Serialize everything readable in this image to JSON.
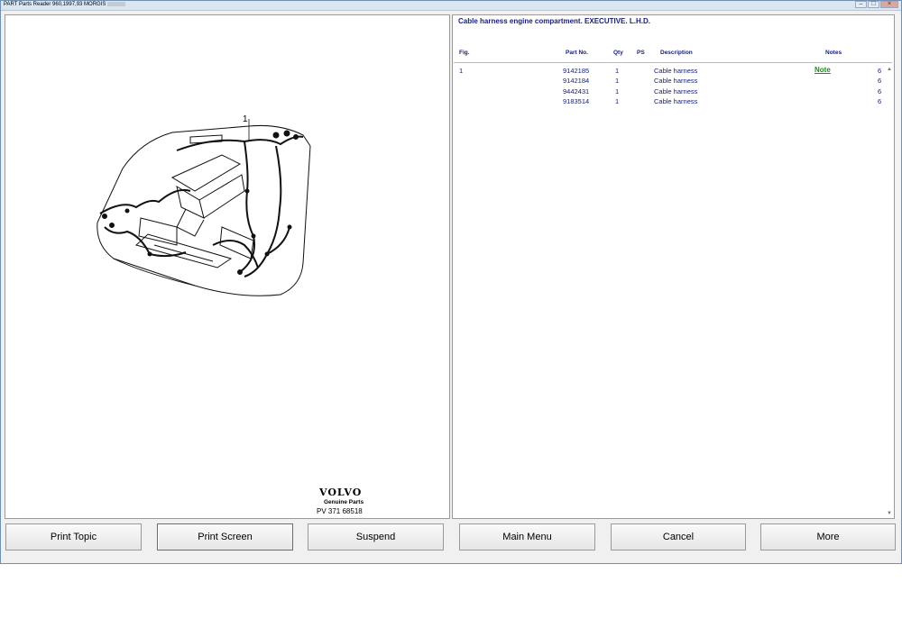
{
  "window": {
    "title": "PART Parts Reader 960,1997,93 MORGIS"
  },
  "illustration": {
    "callout_number": "1",
    "brand": "VOLVO",
    "brand_subtitle": "Genuine Parts",
    "code": "PV 371 68518"
  },
  "parts": {
    "title": "Cable harness engine compartment. EXECUTIVE. L.H.D.",
    "columns": {
      "fig": "Fig.",
      "part_no": "Part No.",
      "qty": "Qty",
      "ps": "PS",
      "description": "Description",
      "notes": "Notes"
    },
    "rows": [
      {
        "fig": "1",
        "part_no": "9142185",
        "qty": "1",
        "ps": "",
        "description": "Cable harness",
        "note": "Note",
        "extra": "6"
      },
      {
        "fig": "",
        "part_no": "9142184",
        "qty": "1",
        "ps": "",
        "description": "Cable harness",
        "note": "",
        "extra": "6"
      },
      {
        "fig": "",
        "part_no": "9442431",
        "qty": "1",
        "ps": "",
        "description": "Cable harness",
        "note": "",
        "extra": "6"
      },
      {
        "fig": "",
        "part_no": "9183514",
        "qty": "1",
        "ps": "",
        "description": "Cable harness",
        "note": "",
        "extra": "6"
      }
    ]
  },
  "buttons": {
    "print_topic": "Print Topic",
    "print_screen": "Print Screen",
    "suspend": "Suspend",
    "main_menu": "Main Menu",
    "cancel": "Cancel",
    "more": "More"
  }
}
